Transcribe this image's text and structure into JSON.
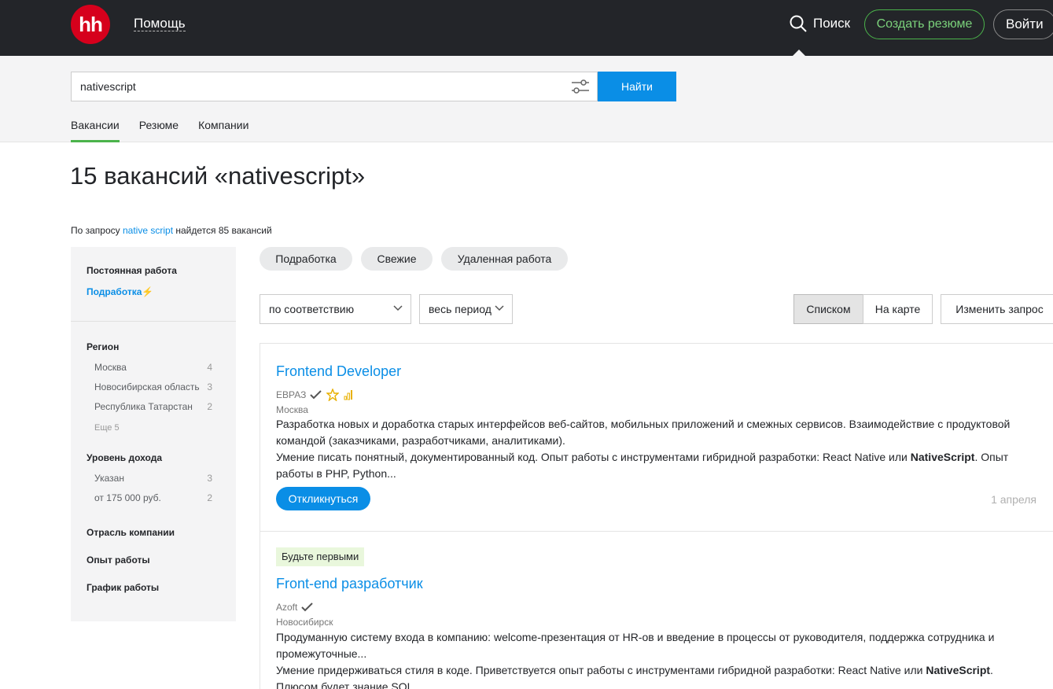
{
  "header": {
    "logo": "hh",
    "help": "Помощь",
    "search": "Поиск",
    "create_resume": "Создать резюме",
    "login": "Войти"
  },
  "search": {
    "value": "nativescript",
    "find_button": "Найти",
    "tabs": [
      "Вакансии",
      "Резюме",
      "Компании"
    ]
  },
  "results": {
    "title": "15 вакансий «nativescript»",
    "note_prefix": "По запросу ",
    "note_link": "native script",
    "note_suffix": " найдется 85 вакансий"
  },
  "sidebar": {
    "employment": "Постоянная работа",
    "part_time": "Подработка",
    "region_title": "Регион",
    "regions": [
      {
        "name": "Москва",
        "count": "4"
      },
      {
        "name": "Новосибирская область",
        "count": "3"
      },
      {
        "name": "Республика Татарстан",
        "count": "2"
      }
    ],
    "more": "Еще 5",
    "income_title": "Уровень дохода",
    "incomes": [
      {
        "name": "Указан",
        "count": "3"
      },
      {
        "name": "от 175 000 руб.",
        "count": "2"
      }
    ],
    "industry": "Отрасль компании",
    "experience": "Опыт работы",
    "schedule": "График работы"
  },
  "chips": [
    "Подработка",
    "Свежие",
    "Удаленная работа"
  ],
  "controls": {
    "sort": "по соответствию",
    "period": "весь период",
    "view_list": "Списком",
    "view_map": "На карте",
    "edit_query": "Изменить запрос"
  },
  "vacancies": [
    {
      "title": "Frontend Developer",
      "company": "ЕВРАЗ",
      "city": "Москва",
      "line1": "Разработка новых и доработка старых интерфейсов веб-сайтов, мобильных приложений и смежных сервисов. Взаимодействие с продуктовой командой (заказчиками, разработчиками, аналитиками).",
      "line2_pre": "Умение писать понятный, документированный код. Опыт работы с инструментами гибридной разработки: React Native или ",
      "line2_bold": "NativeScript",
      "line2_post": ". Опыт работы в PHP, Python...",
      "apply": "Откликнуться",
      "date": "1 апреля"
    },
    {
      "badge": "Будьте первыми",
      "title": "Front-end разработчик",
      "company": "Azoft",
      "city": "Новосибирск",
      "line1": "Продуманную систему входа в компанию: welcome-презентация от HR-ов и введение в процессы от руководителя, поддержка сотрудника и промежуточные...",
      "line2_pre": "Умение придерживаться стиля в коде. Приветствуется опыт работы с инструментами гибридной разработки: React Native или ",
      "line2_bold": "NativeScript",
      "line2_post": ". Плюсом будет знание SQL..."
    }
  ],
  "colors": {
    "brand_red": "#d6001c",
    "link_blue": "#0a8ee6",
    "accent_green": "#4bb34b"
  }
}
